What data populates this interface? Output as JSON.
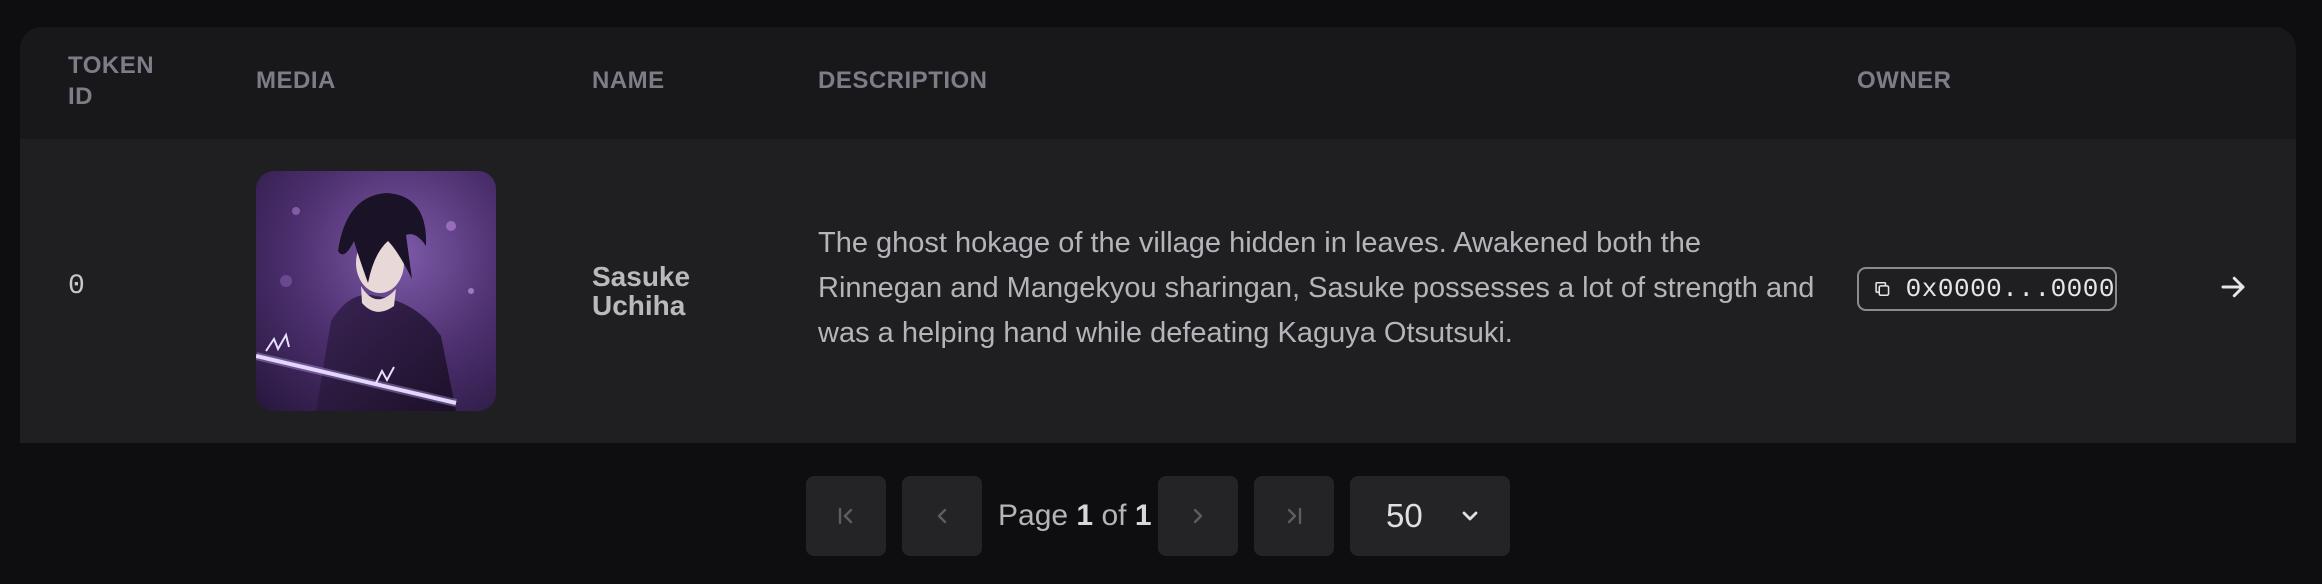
{
  "table": {
    "headers": {
      "token_id": "TOKEN ID",
      "media": "MEDIA",
      "name": "NAME",
      "description": "DESCRIPTION",
      "owner": "OWNER"
    },
    "rows": [
      {
        "token_id": "0",
        "media_icon": "character-artwork-image",
        "name": "Sasuke Uchiha",
        "description": "The ghost hokage of the village hidden in leaves. Awakened both the Rinnegan and Mangekyou sharingan, Sasuke possesses a lot of strength and was a helping hand while defeating Kaguya Otsutsuki.",
        "owner": "0x0000...0000",
        "owner_icon": "copy-icon",
        "action_icon": "arrow-right-icon"
      }
    ]
  },
  "pagination": {
    "page_word": "Page",
    "current": "1",
    "of_word": "of",
    "total": "1",
    "page_size": "50",
    "icons": {
      "first": "first-page-icon",
      "prev": "chevron-left-icon",
      "next": "chevron-right-icon",
      "last": "last-page-icon",
      "dropdown": "chevron-down-icon"
    }
  },
  "colors": {
    "background": "#0e0e10",
    "header_bg": "#18181b",
    "row_bg": "#1f1f22",
    "header_text": "#7c7d86",
    "body_text": "#b4b4ba",
    "button_bg": "#242427"
  }
}
